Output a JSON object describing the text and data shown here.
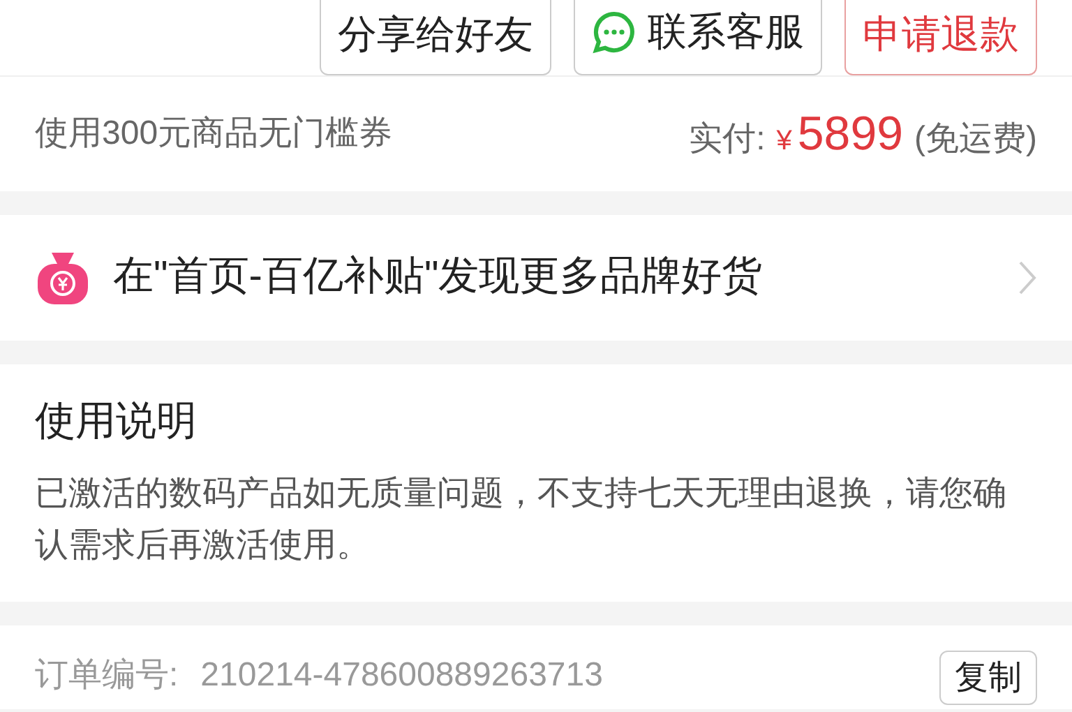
{
  "actions": [
    {
      "label": "分享给好友",
      "kind": "plain"
    },
    {
      "label": "联系客服",
      "kind": "chat"
    },
    {
      "label": "申请退款",
      "kind": "danger"
    }
  ],
  "payment": {
    "coupon": "使用300元商品无门槛券",
    "paid_label": "实付:",
    "currency": "¥",
    "amount": "5899",
    "note": "(免运费)"
  },
  "promo": {
    "text": "在\"首页-百亿补贴\"发现更多品牌好货"
  },
  "instructions": {
    "title": "使用说明",
    "body": "已激活的数码产品如无质量问题，不支持七天无理由退换，请您确认需求后再激活使用。"
  },
  "order": {
    "label": "订单编号:",
    "number": "210214-478600889263713",
    "copy_button": "复制"
  }
}
